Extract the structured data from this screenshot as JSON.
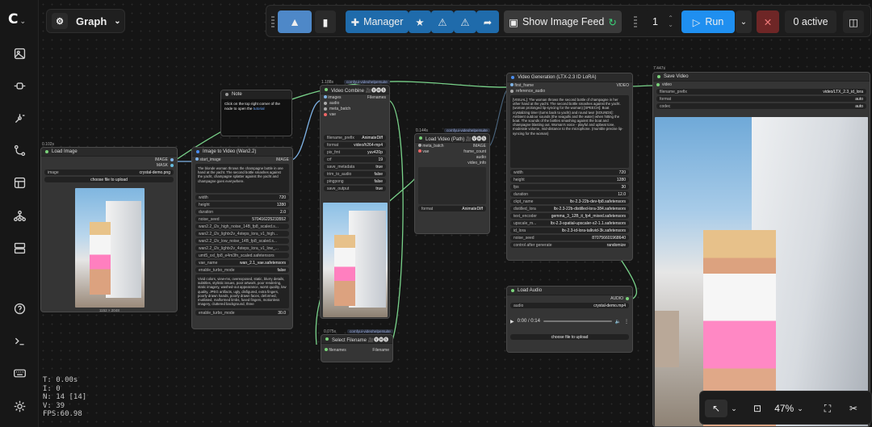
{
  "app": {
    "logo_text": "C",
    "logo_chevron": "⌄"
  },
  "graph_menu": {
    "label": "Graph"
  },
  "toolbar": {
    "manager_label": "Manager",
    "image_feed_label": "Show Image Feed",
    "queue_count": "1",
    "run_label": "Run",
    "active_label": "0 active"
  },
  "sidebar": {
    "items": [
      "images",
      "models",
      "nodes",
      "workflows",
      "templates",
      "model-library",
      "queue",
      "help",
      "console",
      "keybindings",
      "settings"
    ]
  },
  "stats": {
    "t": "T: 0.00s",
    "i": "I: 0",
    "n": "N: 14 [14]",
    "v": "V: 39",
    "fps": "FPS:60.98"
  },
  "nodes": {
    "load_image": {
      "time": "0.102s",
      "title": "Load Image",
      "out1": "IMAGE",
      "out2": "MASK",
      "image_label": "image",
      "image_value": "crystal-demo.png",
      "upload": "choose file to upload",
      "dims": "1152 × 2048"
    },
    "note": {
      "title": "Note",
      "text": "Click on the top right corner of the node to open the",
      "link": "tutorial"
    },
    "i2v": {
      "title": "Image to Video (Wan2.2)",
      "in1": "start_image",
      "out1": "IMAGE",
      "prompt": "The blonde woman throws the champagne bottle in one hand at the yacht. The second bottle smashes against the yacht, champagne splatter against the yacht and champagne goes everywhere.",
      "widgets": [
        [
          "width",
          "720"
        ],
        [
          "height",
          "1280"
        ],
        [
          "duration",
          "2.0"
        ],
        [
          "noise_seed",
          "570416225233552"
        ],
        [
          "wan2.2_i2v_high_noise_14B_fp8_scaled.s...",
          ""
        ],
        [
          "wan2.2_i2v_lightx2v_4steps_lora_v1_high...",
          ""
        ],
        [
          "wan2.2_i2v_low_noise_14B_fp8_scaled.s...",
          ""
        ],
        [
          "wan2.2_i2v_lightx2v_4steps_lora_v1_low_...",
          ""
        ],
        [
          "umt5_xxl_fp8_e4m3fn_scaled.safetensors",
          ""
        ],
        [
          "vae_name",
          "wan_2.1_vae.safetensors"
        ],
        [
          "enable_turbo_mode",
          "false"
        ]
      ],
      "neg": "Vivid colors, view-ms, overexposed, static, blurry details, subtitles, stylistic issues, poor artwork, poor rendering, static imagery, washed-out appearance, worst quality, low quality, JPEG artifacts, ugly, disfigured, extra fingers, poorly drawn hands, poorly drawn faces, deformed, mutilated, malformed limbs, fused fingers, motionless imagery, cluttered background, three",
      "last": [
        "enable_turbo_mode",
        "30.0"
      ]
    },
    "video_combine": {
      "time": "1.188s",
      "badge": "comfyui-videohelpersuite",
      "title": "Video Combine 🎥🅥🅗🅢",
      "in": [
        "images",
        "audio",
        "meta_batch",
        "vae"
      ],
      "out1": "Filenames",
      "widgets": [
        [
          "filename_prefix",
          "AnimateDiff"
        ],
        [
          "format",
          "video/h264-mp4"
        ],
        [
          "pix_fmt",
          "yuv420p"
        ],
        [
          "crf",
          "19"
        ],
        [
          "save_metadata",
          "true"
        ],
        [
          "trim_to_audio",
          "false"
        ],
        [
          "pingpong",
          "false"
        ],
        [
          "save_output",
          "true"
        ]
      ]
    },
    "load_video": {
      "time": "0.144s",
      "badge": "comfyui-videohelpersuite",
      "title": "Load Video (Path) 🎥🅥🅗🅢",
      "in": [
        "meta_batch",
        "vae"
      ],
      "out": [
        "IMAGE",
        "frame_count",
        "audio",
        "video_info"
      ],
      "format": [
        "format",
        "AnimateDiff"
      ]
    },
    "select_filename": {
      "time": "0.075s",
      "badge": "comfyui-videohelpersuite",
      "title": "Select Filename 🎥🅥🅗🅢",
      "in1": "filenames",
      "out1": "Filename"
    },
    "ltx": {
      "title": "Video Generation (LTX-2.3 ID LoRA)",
      "in1": "first_frame",
      "in2": "reference_audio",
      "out1": "VIDEO",
      "prompt": "[VISUAL]: The woman throws the second bottle of champagne in her other hand at the yacht. The second bottle smashes against the yacht. (woman prolonged lip-syncing for the woman) [SPEECH]: Boat crystalizing time! (turns back to yacht) and round two! [SOUNDS]: Ambient outdoor sounds (the seagulls and the water) when hitting the boat. The sounds of the bottles smashing against the boat and champagne blasting out. Woman's voice - playful and upbeat tone, moderate volume, mid-distance to the microphone. (mumble precise lip-syncing for the woman)",
      "widgets": [
        [
          "width",
          "720"
        ],
        [
          "height",
          "1280"
        ],
        [
          "fps",
          "30"
        ],
        [
          "duration",
          "12.0"
        ],
        [
          "ckpt_name",
          "ltx-2.3-22b-dev-fp8.safetensors"
        ],
        [
          "distilled_lora",
          "ltx-2.3-22b-distilled-lora-384.safetensors"
        ],
        [
          "text_encoder",
          "gemma_3_12B_it_fp4_mixed.safetensors"
        ],
        [
          "upscale_m...",
          "ltx-2.3-spatial-upscaler-x2-1.1.safetensors"
        ],
        [
          "id_lora",
          "ltx-2.3-id-lora-talkvid-3k.safetensors"
        ],
        [
          "noise_seed",
          "870756601968640"
        ],
        [
          "control after generate",
          "randomize"
        ]
      ]
    },
    "load_audio": {
      "title": "Load Audio",
      "out1": "AUDIO",
      "audio_label": "audio",
      "audio_value": "crystal-demo.mp4",
      "time_display": "0:00 / 0:14",
      "upload": "choose file to upload"
    },
    "save_video": {
      "time": "7.447s",
      "title": "Save Video",
      "in1": "video",
      "widgets": [
        [
          "filename_prefix",
          "video/LTX_2.3_id_lora"
        ],
        [
          "format",
          "auto"
        ],
        [
          "codec",
          "auto"
        ]
      ]
    }
  },
  "view": {
    "zoom": "47%"
  },
  "colors": {
    "accent_blue": "#1f7fd8",
    "run_blue": "#1f8ff0",
    "stop_red": "#7a2a2a",
    "wire_green": "#79d28a",
    "wire_blue": "#7fb3e6"
  }
}
